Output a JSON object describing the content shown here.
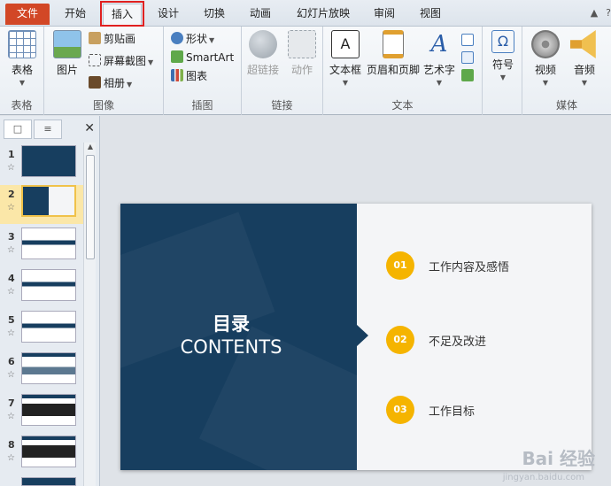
{
  "tabs": {
    "file": "文件",
    "home": "开始",
    "insert": "插入",
    "design": "设计",
    "transitions": "切换",
    "animations": "动画",
    "slideshow": "幻灯片放映",
    "review": "审阅",
    "view": "视图"
  },
  "ribbon": {
    "groups": {
      "tables": "表格",
      "images": "图像",
      "illustrations": "插图",
      "links": "链接",
      "text": "文本",
      "symbols": "",
      "media": "媒体"
    },
    "buttons": {
      "table": "表格",
      "picture": "图片",
      "clipart": "剪贴画",
      "screenshot": "屏幕截图",
      "album": "相册",
      "shapes": "形状",
      "smartart": "SmartArt",
      "chart": "图表",
      "hyperlink": "超链接",
      "action": "动作",
      "textbox": "文本框",
      "header_footer": "页眉和页脚",
      "wordart": "艺术字",
      "symbol": "符号",
      "video": "视频",
      "audio": "音频"
    }
  },
  "slides_pane": {
    "numbers": [
      "1",
      "2",
      "3",
      "4",
      "5",
      "6",
      "7",
      "8"
    ],
    "selected": "2"
  },
  "slide": {
    "title_cn": "目录",
    "title_en": "CONTENTS",
    "items": [
      {
        "num": "01",
        "text": "工作内容及感悟"
      },
      {
        "num": "02",
        "text": "不足及改进"
      },
      {
        "num": "03",
        "text": "工作目标"
      }
    ]
  },
  "watermark": {
    "text": "Bai 经验",
    "sub": "jingyan.baidu.com"
  },
  "colors": {
    "file_tab": "#d24726",
    "slide_dark": "#173e5f",
    "accent_circle": "#f5b400",
    "highlight_box": "#e02020"
  }
}
